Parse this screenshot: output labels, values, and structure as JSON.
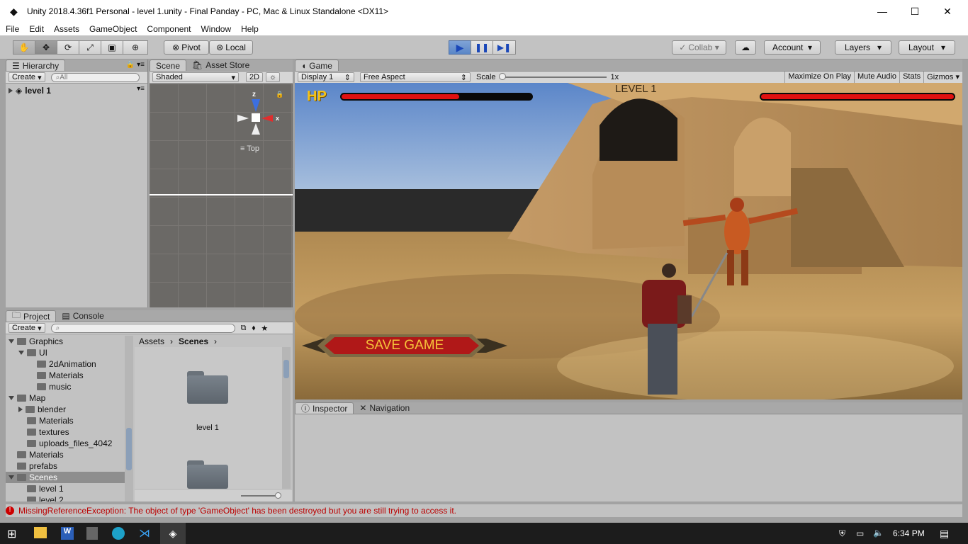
{
  "window": {
    "title": "Unity 2018.4.36f1 Personal - level 1.unity - Final Panday - PC, Mac & Linux Standalone <DX11>"
  },
  "menu": [
    "File",
    "Edit",
    "Assets",
    "GameObject",
    "Component",
    "Window",
    "Help"
  ],
  "toolbar": {
    "pivot": "Pivot",
    "local": "Local",
    "collab": "Collab",
    "account": "Account",
    "layers": "Layers",
    "layout": "Layout"
  },
  "hierarchy": {
    "tab": "Hierarchy",
    "create": "Create",
    "search_placeholder": "All",
    "scene_name": "level 1"
  },
  "scene": {
    "tab_scene": "Scene",
    "tab_store": "Asset Store",
    "shading": "Shaded",
    "mode2d": "2D",
    "gizmo_y": "z",
    "gizmo_x": "x",
    "view_label": "Top"
  },
  "game": {
    "tab": "Game",
    "display": "Display 1",
    "aspect": "Free Aspect",
    "scale_label": "Scale",
    "scale_value": "1x",
    "maximize": "Maximize On Play",
    "mute": "Mute Audio",
    "stats": "Stats",
    "gizmos": "Gizmos",
    "hp_label": "HP",
    "player_hp": 0.62,
    "enemy_hp": 1.0,
    "level_text": "LEVEL 1",
    "save_button": "SAVE GAME"
  },
  "project": {
    "tab_project": "Project",
    "tab_console": "Console",
    "create": "Create",
    "breadcrumb": [
      "Assets",
      "Scenes"
    ],
    "tree": [
      {
        "label": "Graphics",
        "depth": 1,
        "expanded": true
      },
      {
        "label": "UI",
        "depth": 2,
        "expanded": true
      },
      {
        "label": "2dAnimation",
        "depth": 3
      },
      {
        "label": "Materials",
        "depth": 3
      },
      {
        "label": "music",
        "depth": 3
      },
      {
        "label": "Map",
        "depth": 1,
        "expanded": true
      },
      {
        "label": "blender",
        "depth": 2,
        "collapsed": true
      },
      {
        "label": "Materials",
        "depth": 2
      },
      {
        "label": "textures",
        "depth": 2
      },
      {
        "label": "uploads_files_4042",
        "depth": 2
      },
      {
        "label": "Materials",
        "depth": 1
      },
      {
        "label": "prefabs",
        "depth": 1
      },
      {
        "label": "Scenes",
        "depth": 1,
        "expanded": true,
        "selected": true
      },
      {
        "label": "level 1",
        "depth": 2
      },
      {
        "label": "level 2",
        "depth": 2
      }
    ],
    "assets": [
      "level 1",
      ""
    ]
  },
  "inspector": {
    "tab_inspector": "Inspector",
    "tab_navigation": "Navigation"
  },
  "status": {
    "message": "MissingReferenceException: The object of type 'GameObject' has been destroyed but you are still trying to access it."
  },
  "taskbar": {
    "time": "6:34 PM"
  },
  "colors": {
    "play_accent": "#5a86c7",
    "hp_red": "#e01010",
    "error_red": "#b00000"
  }
}
